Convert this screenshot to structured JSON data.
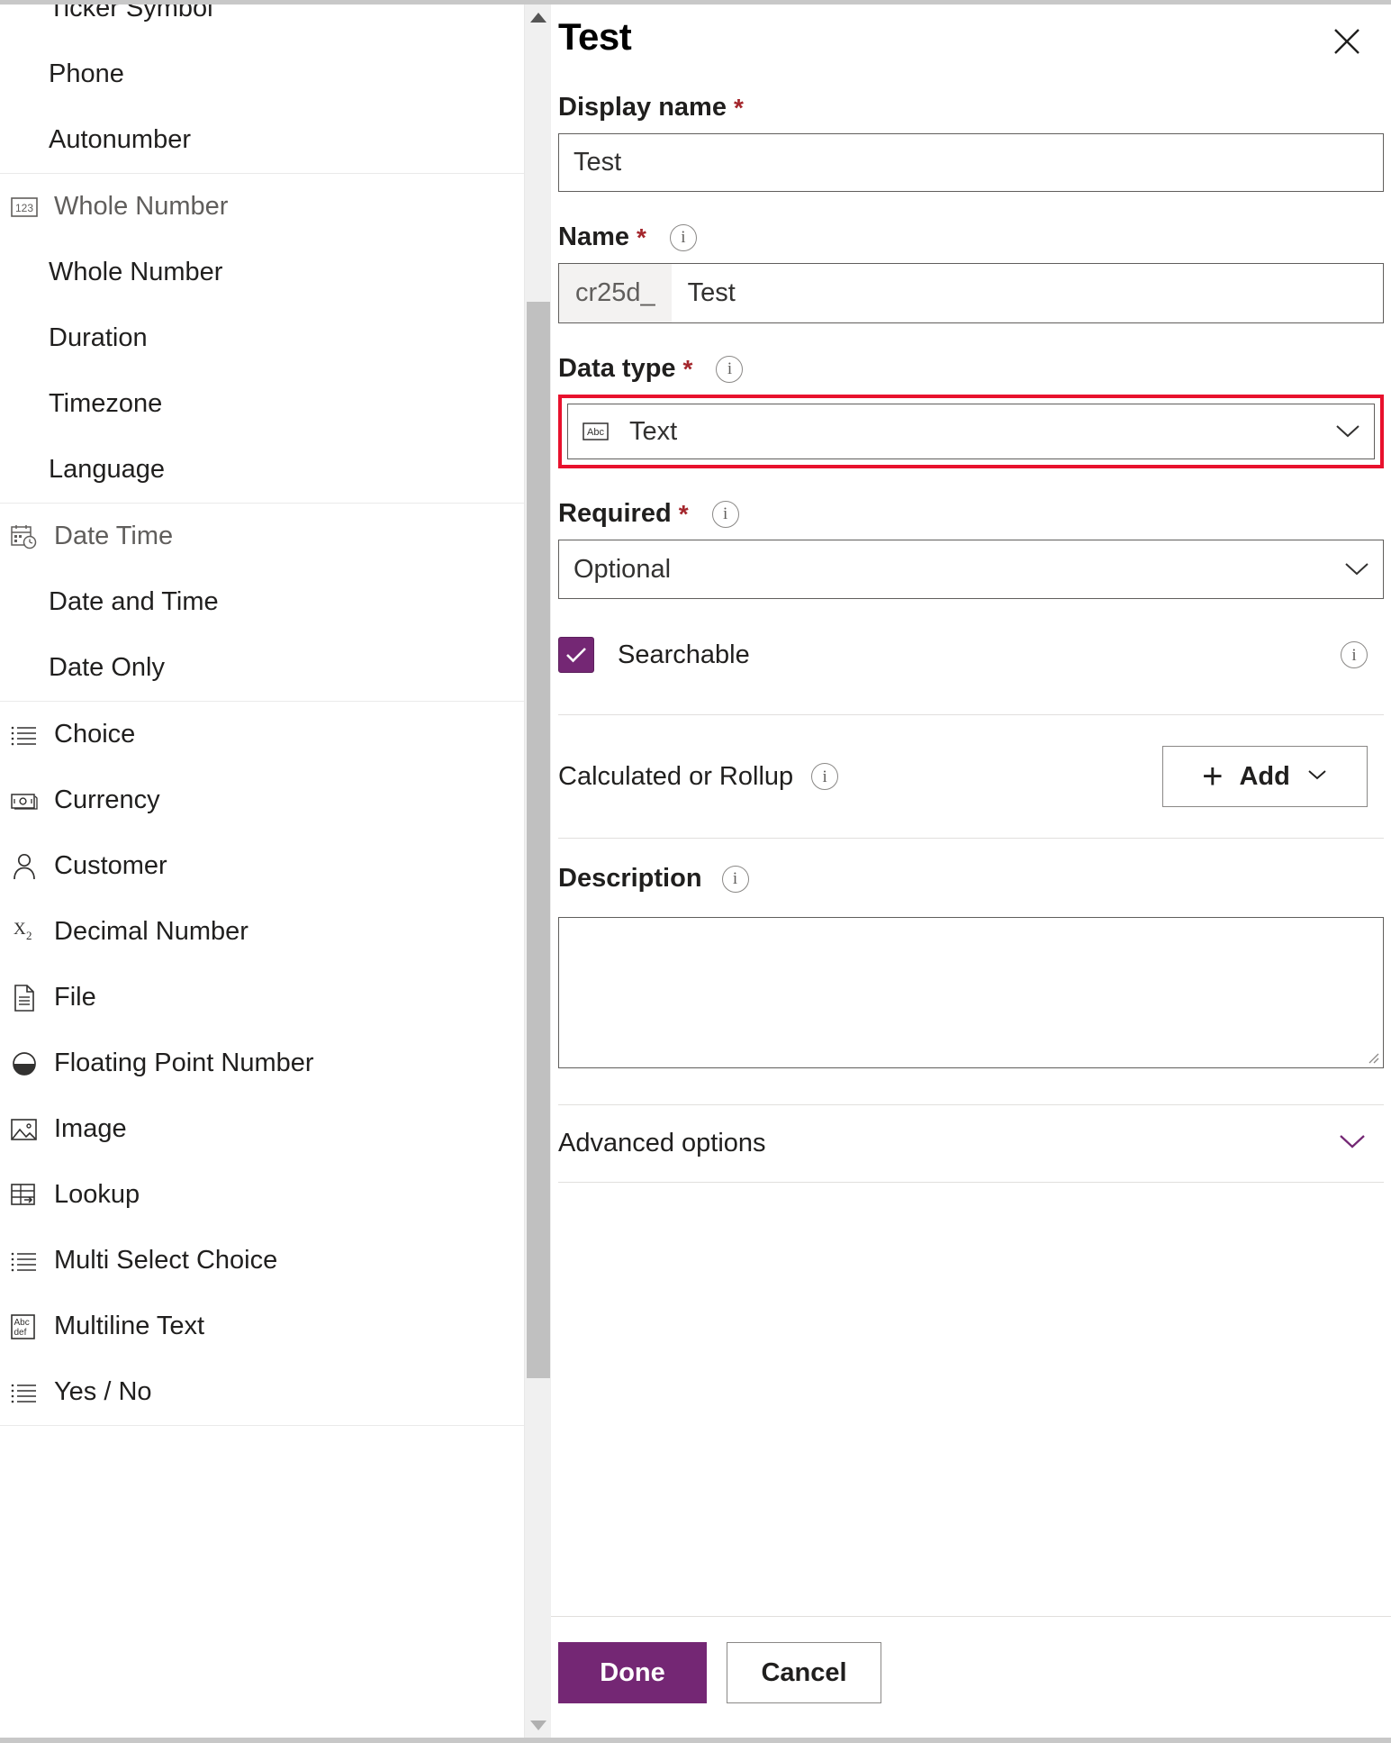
{
  "colors": {
    "accent_purple": "#742774",
    "highlight_red": "#e8112d",
    "required_asterisk": "#a4262c",
    "label_text": "#201f1e",
    "muted_text": "#605e5c"
  },
  "data_type_list": {
    "groups": [
      {
        "header": null,
        "header_icon": null,
        "partial_top_item": "Ticker Symbol",
        "items": [
          {
            "label": "Phone",
            "icon": null
          },
          {
            "label": "Autonumber",
            "icon": null
          }
        ]
      },
      {
        "header": "Whole Number",
        "header_icon": "whole-number-123-icon",
        "items": [
          {
            "label": "Whole Number",
            "icon": null
          },
          {
            "label": "Duration",
            "icon": null
          },
          {
            "label": "Timezone",
            "icon": null
          },
          {
            "label": "Language",
            "icon": null
          }
        ]
      },
      {
        "header": "Date Time",
        "header_icon": "calendar-clock-icon",
        "items": [
          {
            "label": "Date and Time",
            "icon": null
          },
          {
            "label": "Date Only",
            "icon": null
          }
        ]
      },
      {
        "header": null,
        "items": [
          {
            "label": "Choice",
            "icon": "choice-list-icon"
          },
          {
            "label": "Currency",
            "icon": "currency-banknote-icon"
          },
          {
            "label": "Customer",
            "icon": "person-icon"
          },
          {
            "label": "Decimal Number",
            "icon": "decimal-x2-icon"
          },
          {
            "label": "File",
            "icon": "file-document-icon"
          },
          {
            "label": "Floating Point Number",
            "icon": "floating-point-half-circle-icon"
          },
          {
            "label": "Image",
            "icon": "image-picture-icon"
          },
          {
            "label": "Lookup",
            "icon": "lookup-table-arrow-icon"
          },
          {
            "label": "Multi Select Choice",
            "icon": "choice-list-icon"
          },
          {
            "label": "Multiline Text",
            "icon": "abc-def-multiline-icon"
          },
          {
            "label": "Yes / No",
            "icon": "choice-list-icon"
          }
        ]
      }
    ]
  },
  "scrollbar": {
    "up_arrow": "scroll-up-arrow",
    "down_arrow": "scroll-down-arrow",
    "thumb": "scroll-thumb"
  },
  "panel": {
    "title": "Test",
    "close_icon": "close-x-icon",
    "display_name": {
      "label": "Display name",
      "required_marker": "*",
      "value": "Test"
    },
    "name": {
      "label": "Name",
      "required_marker": "*",
      "info_icon": "info-icon",
      "prefix": "cr25d_",
      "value": "Test"
    },
    "data_type": {
      "label": "Data type",
      "required_marker": "*",
      "info_icon": "info-icon",
      "selected": "Text",
      "selected_icon": "abc-text-icon",
      "chevron_icon": "chevron-down-icon",
      "highlighted": true
    },
    "required_field": {
      "label": "Required",
      "required_marker": "*",
      "info_icon": "info-icon",
      "selected": "Optional",
      "chevron_icon": "chevron-down-icon"
    },
    "searchable": {
      "label": "Searchable",
      "checked": true,
      "checkbox_icon": "checkmark-icon",
      "info_icon": "info-icon"
    },
    "calculated_or_rollup": {
      "label": "Calculated or Rollup",
      "info_icon": "info-icon",
      "add_button": {
        "label": "Add",
        "plus_icon": "plus-icon",
        "chevron_icon": "chevron-down-icon"
      }
    },
    "description": {
      "label": "Description",
      "info_icon": "info-icon",
      "value": "",
      "resize_grip": "resize-grip-icon"
    },
    "advanced_options": {
      "label": "Advanced options",
      "chevron_icon": "chevron-down-icon",
      "expanded": false
    },
    "footer": {
      "done_label": "Done",
      "cancel_label": "Cancel"
    }
  }
}
